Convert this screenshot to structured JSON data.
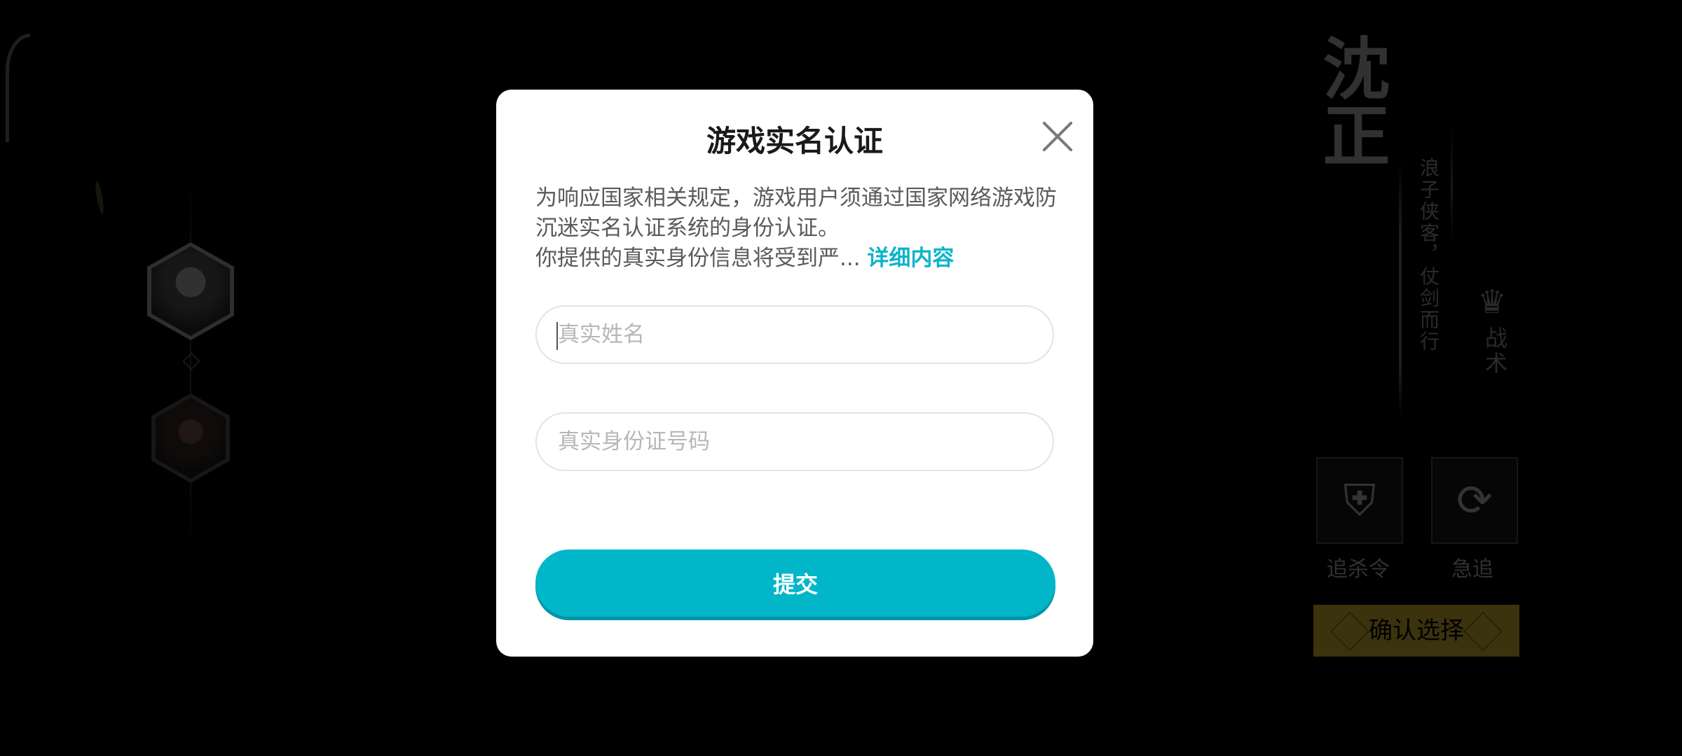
{
  "background": {
    "hero_name": "沈正",
    "hero_motto": "浪子侠客，仗剑而行",
    "tactic": {
      "icon": "crown-emblem-icon",
      "label": "战术"
    },
    "skills": [
      {
        "icon": "shield-sword-icon",
        "label": "追杀令"
      },
      {
        "icon": "running-figure-icon",
        "label": "急追"
      }
    ],
    "confirm_label": "确认选择"
  },
  "modal": {
    "title": "游戏实名认证",
    "notice_line1": "为响应国家相关规定，游戏用户须通过国家网络游戏防沉迷实名认证系统的身份认证。",
    "notice_line2": "你提供的真实身份信息将受到严... ",
    "detail_link": "详细内容",
    "name_placeholder": "真实姓名",
    "id_placeholder": "真实身份证号码",
    "submit_label": "提交",
    "accent_color": "#00b6c8"
  }
}
